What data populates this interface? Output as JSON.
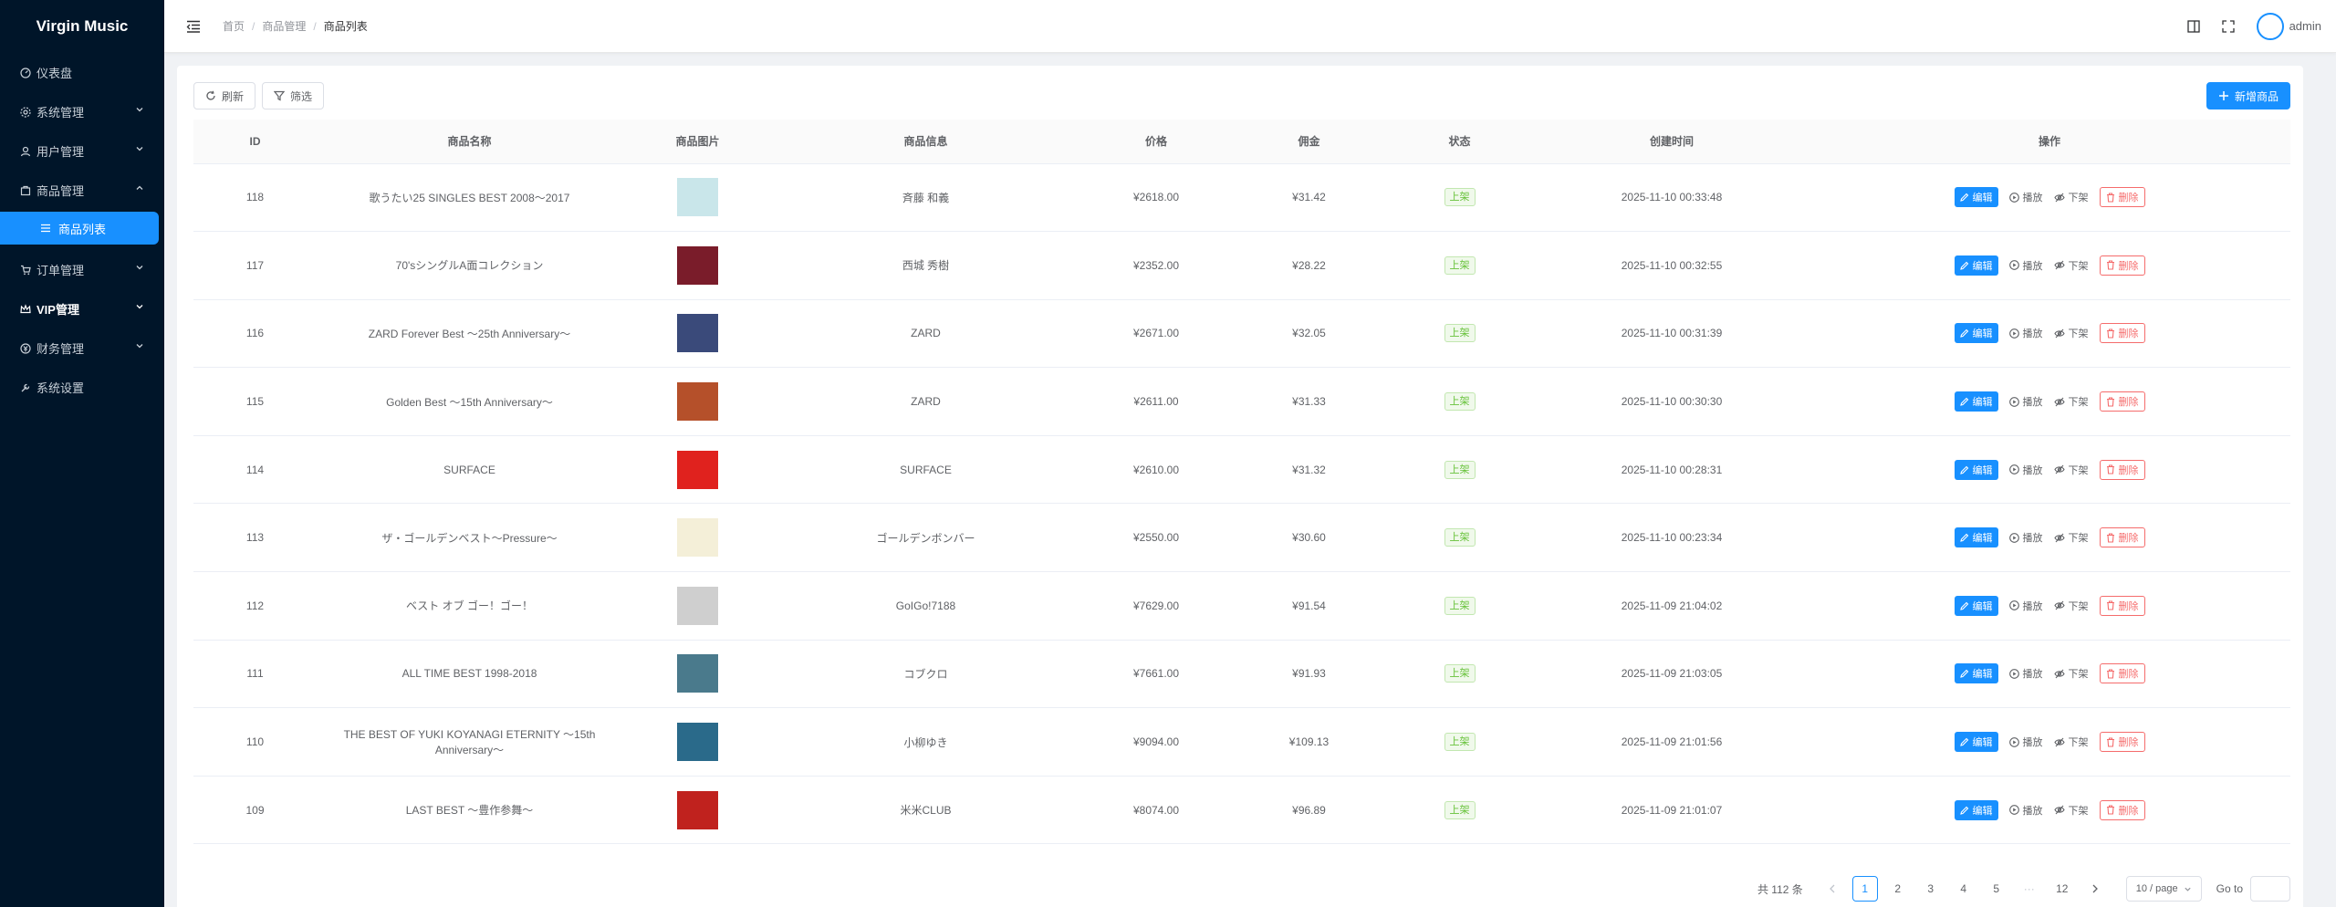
{
  "app": {
    "title": "Virgin Music"
  },
  "sidebar": {
    "items": [
      {
        "label": "仪表盘",
        "icon": "dashboard-icon"
      },
      {
        "label": "系统管理",
        "icon": "settings-icon"
      },
      {
        "label": "用户管理",
        "icon": "user-icon"
      },
      {
        "label": "商品管理",
        "icon": "shop-icon",
        "expanded": true
      },
      {
        "label": "订单管理",
        "icon": "cart-icon"
      },
      {
        "label": "VIP管理",
        "icon": "crown-icon"
      },
      {
        "label": "财务管理",
        "icon": "finance-icon"
      },
      {
        "label": "系统设置",
        "icon": "wrench-icon"
      }
    ],
    "active_sub": "商品列表"
  },
  "header": {
    "breadcrumb": [
      "首页",
      "商品管理",
      "商品列表"
    ],
    "user": "admin"
  },
  "toolbar": {
    "refresh": "刷新",
    "filter": "筛选",
    "add": "新增商品"
  },
  "table": {
    "headers": [
      "ID",
      "商品名称",
      "商品图片",
      "商品信息",
      "价格",
      "佣金",
      "状态",
      "创建时间",
      "操作"
    ],
    "rows": [
      {
        "id": "118",
        "name": "歌うたい25 SINGLES BEST 2008～2017",
        "info": "斉藤 和義",
        "price": "¥2618.00",
        "commission": "¥31.42",
        "status": "上架",
        "created": "2025-11-10 00:33:48",
        "thumb": "#c9e6ea"
      },
      {
        "id": "117",
        "name": "70'sシングルA面コレクション",
        "info": "西城 秀樹",
        "price": "¥2352.00",
        "commission": "¥28.22",
        "status": "上架",
        "created": "2025-11-10 00:32:55",
        "thumb": "#7a1c2a"
      },
      {
        "id": "116",
        "name": "ZARD Forever Best ～25th Anniversary～",
        "info": "ZARD",
        "price": "¥2671.00",
        "commission": "¥32.05",
        "status": "上架",
        "created": "2025-11-10 00:31:39",
        "thumb": "#3a4a7a"
      },
      {
        "id": "115",
        "name": "Golden Best ～15th Anniversary～",
        "info": "ZARD",
        "price": "¥2611.00",
        "commission": "¥31.33",
        "status": "上架",
        "created": "2025-11-10 00:30:30",
        "thumb": "#b5502a"
      },
      {
        "id": "114",
        "name": "SURFACE",
        "info": "SURFACE",
        "price": "¥2610.00",
        "commission": "¥31.32",
        "status": "上架",
        "created": "2025-11-10 00:28:31",
        "thumb": "#e0221e"
      },
      {
        "id": "113",
        "name": "ザ・ゴールデンベスト～Pressure～",
        "info": "ゴールデンボンバー",
        "price": "¥2550.00",
        "commission": "¥30.60",
        "status": "上架",
        "created": "2025-11-10 00:23:34",
        "thumb": "#f4efd8"
      },
      {
        "id": "112",
        "name": "ベスト オブ ゴー！ゴー！",
        "info": "GoIGo!7188",
        "price": "¥7629.00",
        "commission": "¥91.54",
        "status": "上架",
        "created": "2025-11-09 21:04:02",
        "thumb": "#cfcfcf"
      },
      {
        "id": "111",
        "name": "ALL TIME BEST 1998-2018",
        "info": "コブクロ",
        "price": "¥7661.00",
        "commission": "¥91.93",
        "status": "上架",
        "created": "2025-11-09 21:03:05",
        "thumb": "#4a7a8c"
      },
      {
        "id": "110",
        "name": "THE BEST OF YUKI KOYANAGI ETERNITY ～15th Anniversary～",
        "info": "小柳ゆき",
        "price": "¥9094.00",
        "commission": "¥109.13",
        "status": "上架",
        "created": "2025-11-09 21:01:56",
        "thumb": "#2a6a8a"
      },
      {
        "id": "109",
        "name": "LAST BEST ～豊作参舞～",
        "info": "米米CLUB",
        "price": "¥8074.00",
        "commission": "¥96.89",
        "status": "上架",
        "created": "2025-11-09 21:01:07",
        "thumb": "#c0221e"
      }
    ],
    "actions": {
      "edit": "编辑",
      "play": "播放",
      "offline": "下架",
      "delete": "删除"
    }
  },
  "pagination": {
    "total": "共 112 条",
    "pages": [
      "1",
      "2",
      "3",
      "4",
      "5",
      "···",
      "12"
    ],
    "current": "1",
    "size": "10 / page",
    "goto": "Go to"
  }
}
